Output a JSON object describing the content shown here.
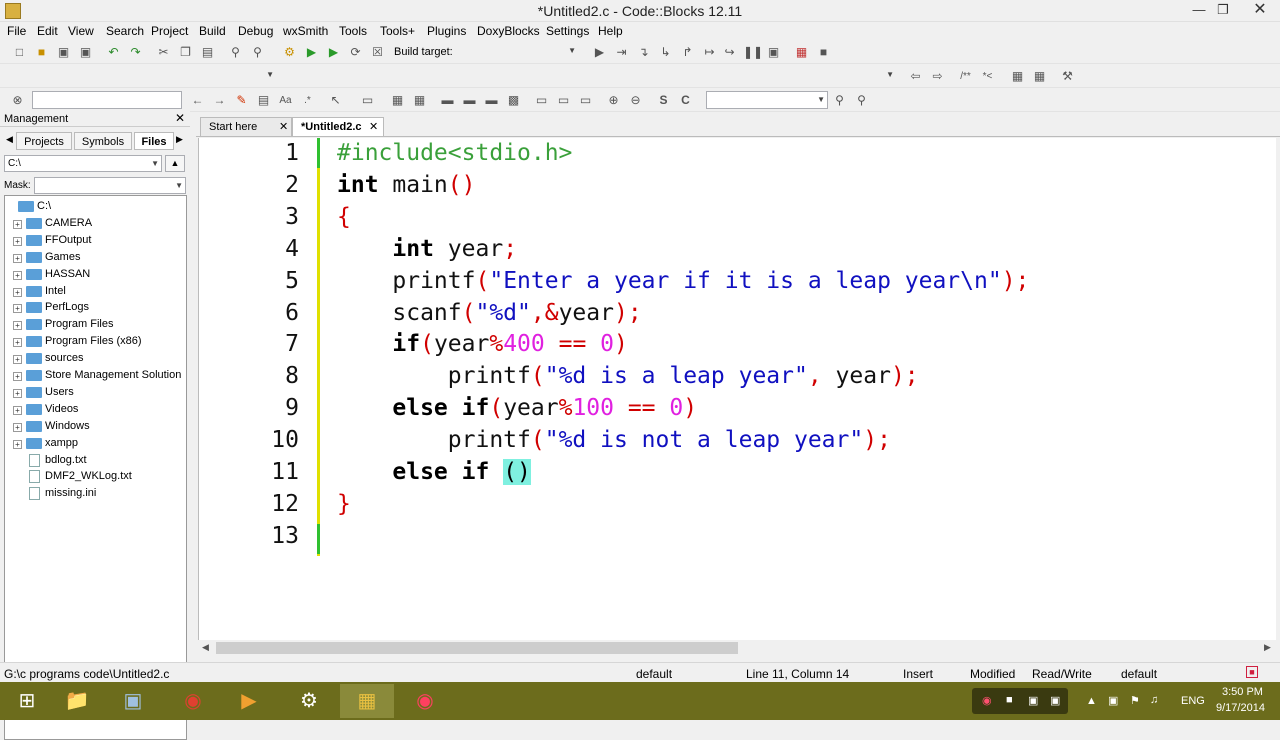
{
  "window": {
    "title": "*Untitled2.c - Code::Blocks 12.11"
  },
  "menu": [
    "File",
    "Edit",
    "View",
    "Search",
    "Project",
    "Build",
    "Debug",
    "wxSmith",
    "Tools",
    "Tools+",
    "Plugins",
    "DoxyBlocks",
    "Settings",
    "Help"
  ],
  "toolbar": {
    "build_target_label": "Build target:",
    "build_target_value": ""
  },
  "management": {
    "title": "Management",
    "tabs": [
      "Projects",
      "Symbols",
      "Files"
    ],
    "drive": "C:\\",
    "mask_label": "Mask:",
    "mask_value": "",
    "tree": [
      {
        "label": "C:\\",
        "type": "folder",
        "expand": false
      },
      {
        "label": "CAMERA",
        "type": "folder",
        "expand": true
      },
      {
        "label": "FFOutput",
        "type": "folder",
        "expand": true
      },
      {
        "label": "Games",
        "type": "folder",
        "expand": true
      },
      {
        "label": "HASSAN",
        "type": "folder",
        "expand": true
      },
      {
        "label": "Intel",
        "type": "folder",
        "expand": true
      },
      {
        "label": "PerfLogs",
        "type": "folder",
        "expand": true
      },
      {
        "label": "Program Files",
        "type": "folder",
        "expand": true
      },
      {
        "label": "Program Files (x86)",
        "type": "folder",
        "expand": true
      },
      {
        "label": "sources",
        "type": "folder",
        "expand": true
      },
      {
        "label": "Store Management Solution",
        "type": "folder",
        "expand": true
      },
      {
        "label": "Users",
        "type": "folder",
        "expand": true
      },
      {
        "label": "Videos",
        "type": "folder",
        "expand": true
      },
      {
        "label": "Windows",
        "type": "folder",
        "expand": true
      },
      {
        "label": "xampp",
        "type": "folder",
        "expand": true
      },
      {
        "label": "bdlog.txt",
        "type": "file",
        "expand": false
      },
      {
        "label": "DMF2_WKLog.txt",
        "type": "file",
        "expand": false
      },
      {
        "label": "missing.ini",
        "type": "file",
        "expand": false
      }
    ]
  },
  "editor": {
    "tabs": [
      {
        "label": "Start here",
        "active": false
      },
      {
        "label": "*Untitled2.c",
        "active": true
      }
    ],
    "lines": [
      {
        "n": "1",
        "tokens": [
          [
            "pp",
            "#include<stdio.h>"
          ]
        ]
      },
      {
        "n": "2",
        "tokens": [
          [
            "kw",
            "int"
          ],
          [
            "tx",
            " main"
          ],
          [
            "op",
            "()"
          ]
        ]
      },
      {
        "n": "3",
        "tokens": [
          [
            "op",
            "{"
          ]
        ]
      },
      {
        "n": "4",
        "tokens": [
          [
            "tx",
            "    "
          ],
          [
            "kw",
            "int"
          ],
          [
            "tx",
            " year"
          ],
          [
            "op",
            ";"
          ]
        ]
      },
      {
        "n": "5",
        "tokens": [
          [
            "tx",
            "    printf"
          ],
          [
            "op",
            "("
          ],
          [
            "st",
            "\"Enter a year if it is a leap year\\n\""
          ],
          [
            "op",
            ");"
          ]
        ]
      },
      {
        "n": "6",
        "tokens": [
          [
            "tx",
            "    scanf"
          ],
          [
            "op",
            "("
          ],
          [
            "st",
            "\"%d\""
          ],
          [
            "op",
            ",&"
          ],
          [
            "tx",
            "year"
          ],
          [
            "op",
            ");"
          ]
        ]
      },
      {
        "n": "7",
        "tokens": [
          [
            "tx",
            "    "
          ],
          [
            "kw",
            "if"
          ],
          [
            "op",
            "("
          ],
          [
            "tx",
            "year"
          ],
          [
            "op",
            "%"
          ],
          [
            "num",
            "400"
          ],
          [
            "op",
            " == "
          ],
          [
            "num",
            "0"
          ],
          [
            "op",
            ")"
          ]
        ]
      },
      {
        "n": "8",
        "tokens": [
          [
            "tx",
            "        printf"
          ],
          [
            "op",
            "("
          ],
          [
            "st",
            "\"%d is a leap year\""
          ],
          [
            "op",
            ","
          ],
          [
            "tx",
            " year"
          ],
          [
            "op",
            ");"
          ]
        ]
      },
      {
        "n": "9",
        "tokens": [
          [
            "tx",
            "    "
          ],
          [
            "kw",
            "else if"
          ],
          [
            "op",
            "("
          ],
          [
            "tx",
            "year"
          ],
          [
            "op",
            "%"
          ],
          [
            "num",
            "100"
          ],
          [
            "op",
            " == "
          ],
          [
            "num",
            "0"
          ],
          [
            "op",
            ")"
          ]
        ]
      },
      {
        "n": "10",
        "tokens": [
          [
            "tx",
            "        printf"
          ],
          [
            "op",
            "("
          ],
          [
            "st",
            "\"%d is not a leap year\""
          ],
          [
            "op",
            ");"
          ]
        ]
      },
      {
        "n": "11",
        "tokens": [
          [
            "tx",
            "    "
          ],
          [
            "kw",
            "else if"
          ],
          [
            "tx",
            " "
          ],
          [
            "br",
            "()"
          ]
        ]
      },
      {
        "n": "12",
        "tokens": [
          [
            "op",
            "}"
          ]
        ]
      },
      {
        "n": "13",
        "tokens": []
      }
    ]
  },
  "status": {
    "path": "G:\\c programs code\\Untitled2.c",
    "encoding": "default",
    "position": "Line 11, Column 14",
    "mode": "Insert",
    "modified": "Modified",
    "access": "Read/Write",
    "lang": "default"
  },
  "taskbar": {
    "lang": "ENG",
    "time": "3:50 PM",
    "date": "9/17/2014"
  },
  "colors": {
    "taskbar": "#6c6c1c",
    "keyword": "#000000",
    "preprocessor": "#3aa03a",
    "string": "#1010c0",
    "number": "#e020e0",
    "operator": "#d00000"
  }
}
